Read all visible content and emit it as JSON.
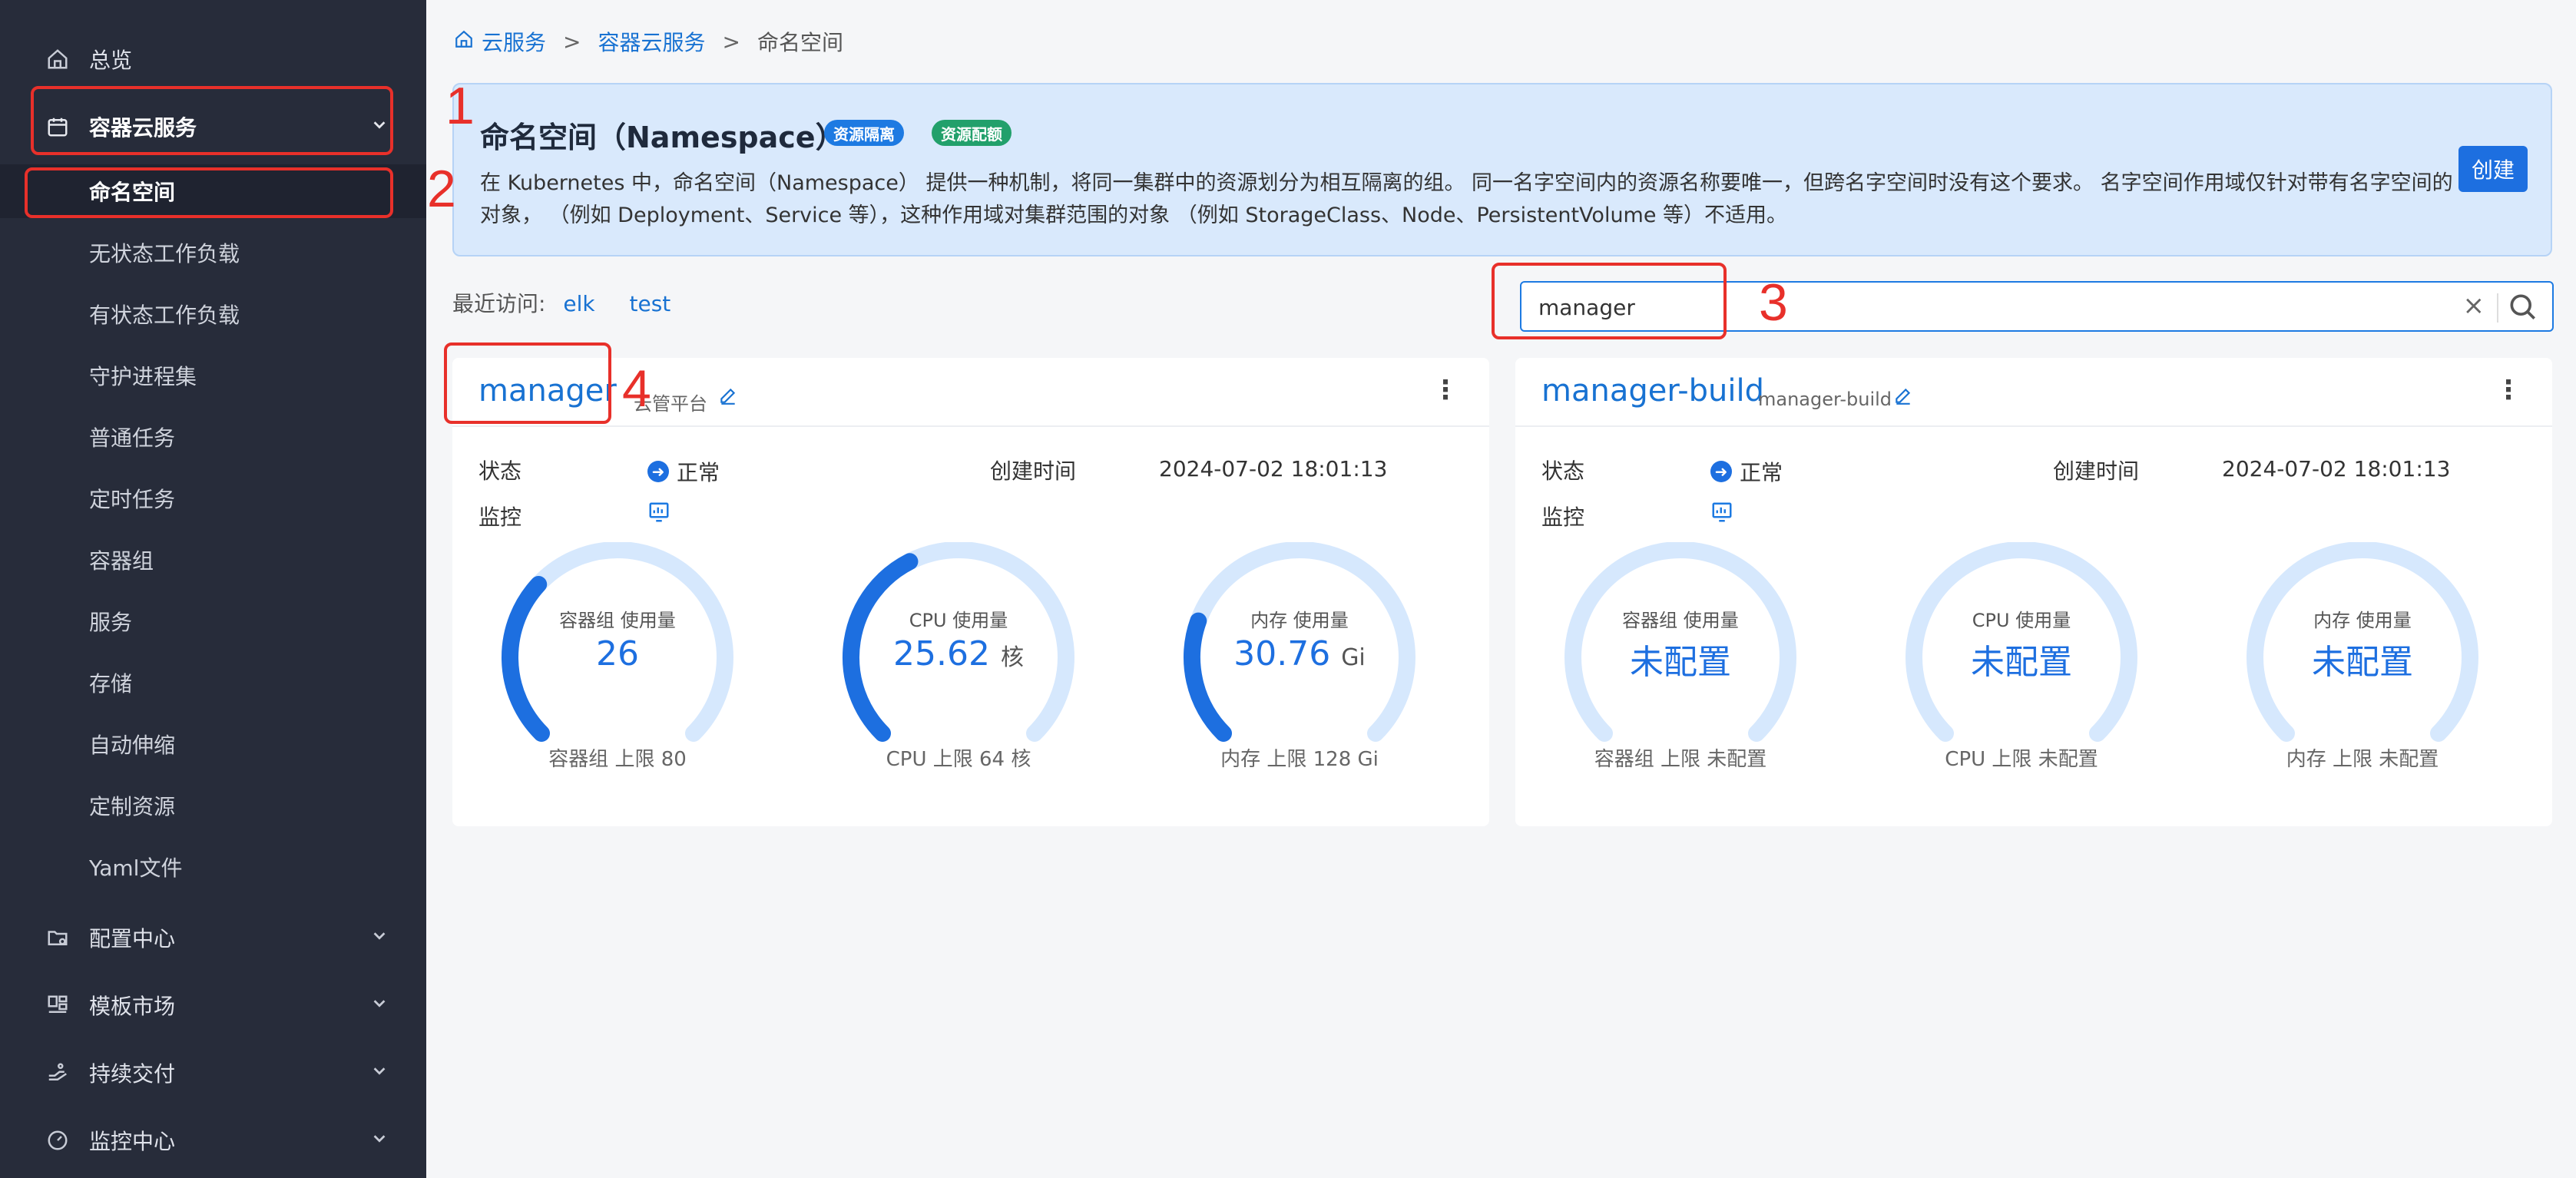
{
  "sidebar": {
    "overview": "总览",
    "container_service": "容器云服务",
    "sub_items": [
      "命名空间",
      "无状态工作负载",
      "有状态工作负载",
      "守护进程集",
      "普通任务",
      "定时任务",
      "容器组",
      "服务",
      "存储",
      "自动伸缩",
      "定制资源",
      "Yaml文件"
    ],
    "config_center": "配置中心",
    "template_market": "模板市场",
    "continuous_delivery": "持续交付",
    "monitor_center": "监控中心"
  },
  "annotations": [
    "1",
    "2",
    "3",
    "4"
  ],
  "breadcrumb": {
    "item1": "云服务",
    "item2": "容器云服务",
    "item3": "命名空间",
    "sep": ">"
  },
  "banner": {
    "title": "命名空间（Namespace）",
    "tag1": "资源隔离",
    "tag2": "资源配额",
    "desc": "在 Kubernetes 中，命名空间（Namespace） 提供一种机制，将同一集群中的资源划分为相互隔离的组。 同一名字空间内的资源名称要唯一，但跨名字空间时没有这个要求。 名字空间作用域仅针对带有名字空间的对象， （例如 Deployment、Service 等），这种作用域对集群范围的对象 （例如 StorageClass、Node、PersistentVolume 等）不适用。",
    "create_label": "创建"
  },
  "recent": {
    "label": "最近访问:",
    "links": [
      "elk",
      "test"
    ]
  },
  "search": {
    "value": "manager"
  },
  "labels": {
    "status": "状态",
    "monitor": "监控",
    "created": "创建时间"
  },
  "cards": [
    {
      "name": "manager",
      "alias": "云管平台",
      "status": "正常",
      "created": "2024-07-02 18:01:13",
      "gauges": [
        {
          "name": "容器组 使用量",
          "value": "26",
          "unit": "",
          "limit": "容器组 上限 80",
          "fraction": 0.325
        },
        {
          "name": "CPU 使用量",
          "value": "25.62",
          "unit": "核",
          "limit": "CPU 上限 64 核",
          "fraction": 0.4
        },
        {
          "name": "内存 使用量",
          "value": "30.76",
          "unit": "Gi",
          "limit": "内存 上限 128 Gi",
          "fraction": 0.24
        }
      ]
    },
    {
      "name": "manager-build",
      "alias": "manager-build",
      "status": "正常",
      "created": "2024-07-02 18:01:13",
      "gauges": [
        {
          "name": "容器组 使用量",
          "value": "未配置",
          "unit": "",
          "limit": "容器组 上限 未配置",
          "fraction": 0
        },
        {
          "name": "CPU 使用量",
          "value": "未配置",
          "unit": "",
          "limit": "CPU 上限 未配置",
          "fraction": 0
        },
        {
          "name": "内存 使用量",
          "value": "未配置",
          "unit": "",
          "limit": "内存 上限 未配置",
          "fraction": 0
        }
      ]
    }
  ],
  "colors": {
    "sidebar_bg": "#272c3a",
    "accent": "#1d6fe0",
    "annotation": "#e8302a",
    "gauge_track": "#d6e8fd"
  }
}
